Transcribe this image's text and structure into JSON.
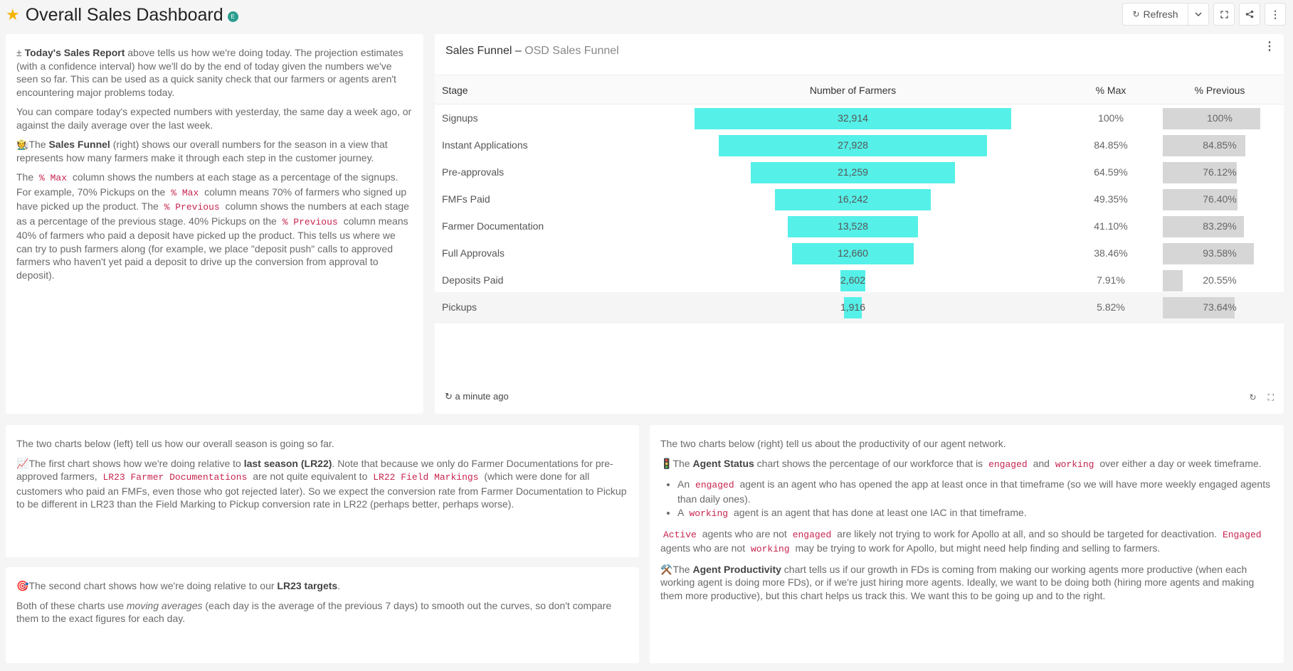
{
  "header": {
    "title": "Overall Sales Dashboard",
    "star_icon": "star-icon",
    "certified_badge": "E",
    "refresh_label": "Refresh"
  },
  "intro": {
    "p1_icon": "±",
    "p1_bold": "Today's Sales Report",
    "p1_rest": " above tells us how we're doing today. The projection estimates (with a confidence interval) how we'll do by the end of today given the numbers we've seen so far. This can be used as a quick sanity check that our farmers or agents aren't encountering major problems today.",
    "p2": "You can compare today's expected numbers with yesterday, the same day a week ago, or against the daily average over the last week.",
    "p3_icon": "🧑‍🌾",
    "p3_a": "The ",
    "p3_bold": "Sales Funnel",
    "p3_b": " (right) shows our overall numbers for the season in a view that represents how many farmers make it through each step in the customer journey.",
    "p4_a": "The ",
    "p4_code1": "% Max",
    "p4_b": " column shows the numbers at each stage as a percentage of the signups. For example, 70% Pickups on the ",
    "p4_code2": "% Max",
    "p4_c": " column means 70% of farmers who signed up have picked up the product. The ",
    "p4_code3": "% Previous",
    "p4_d": " column shows the numbers at each stage as a percentage of the previous stage. 40% Pickups on the ",
    "p4_code4": "% Previous",
    "p4_e": " column means 40% of farmers who paid a deposit have picked up the product. This tells us where we can try to push farmers along (for example, we place \"deposit push\" calls to approved farmers who haven't yet paid a deposit to drive up the conversion from approval to deposit)."
  },
  "funnel": {
    "title": "Sales Funnel",
    "dash": " – ",
    "subtitle": "OSD Sales Funnel",
    "columns": [
      "Stage",
      "Number of Farmers",
      "% Max",
      "% Previous"
    ],
    "bar_color": "#55f0e8",
    "prev_bar_color": "#d6d6d6",
    "rows": [
      {
        "stage": "Signups",
        "farmers": "32,914",
        "pct_max": "100%",
        "pct_prev": "100%",
        "prev_frac": 1.0
      },
      {
        "stage": "Instant Applications",
        "farmers": "27,928",
        "pct_max": "84.85%",
        "pct_prev": "84.85%",
        "prev_frac": 0.8485
      },
      {
        "stage": "Pre-approvals",
        "farmers": "21,259",
        "pct_max": "64.59%",
        "pct_prev": "76.12%",
        "prev_frac": 0.7612
      },
      {
        "stage": "FMFs Paid",
        "farmers": "16,242",
        "pct_max": "49.35%",
        "pct_prev": "76.40%",
        "prev_frac": 0.764
      },
      {
        "stage": "Farmer Documentation",
        "farmers": "13,528",
        "pct_max": "41.10%",
        "pct_prev": "83.29%",
        "prev_frac": 0.8329
      },
      {
        "stage": "Full Approvals",
        "farmers": "12,660",
        "pct_max": "38.46%",
        "pct_prev": "93.58%",
        "prev_frac": 0.9358
      },
      {
        "stage": "Deposits Paid",
        "farmers": "2,602",
        "pct_max": "7.91%",
        "pct_prev": "20.55%",
        "prev_frac": 0.2055
      },
      {
        "stage": "Pickups",
        "farmers": "1,916",
        "pct_max": "5.82%",
        "pct_prev": "73.64%",
        "prev_frac": 0.7364
      }
    ],
    "updated": "a minute ago"
  },
  "season": {
    "p1": "The two charts below (left) tell us how our overall season is going so far.",
    "p2_icon": "📈",
    "p2_a": "The first chart shows how we're doing relative to ",
    "p2_bold": "last season (LR22)",
    "p2_b": ". Note that because we only do Farmer Documentations for pre-approved farmers, ",
    "p2_code1": "LR23 Farmer Documentations",
    "p2_c": " are not quite equivalent to ",
    "p2_code2": "LR22 Field Markings",
    "p2_d": " (which were done for all customers who paid an FMFs, even those who got rejected later). So we expect the conversion rate from Farmer Documentation to Pickup to be different in LR23 than the Field Marking to Pickup conversion rate in LR22 (perhaps better, perhaps worse)."
  },
  "targets": {
    "p1_icon": "🎯",
    "p1_a": "The second chart shows how we're doing relative to our ",
    "p1_bold": "LR23 targets",
    "p1_b": ".",
    "p2_a": "Both of these charts use ",
    "p2_em": "moving averages",
    "p2_b": " (each day is the average of the previous 7 days) to smooth out the curves, so don't compare them to the exact figures for each day."
  },
  "agents": {
    "p1": "The two charts below (right) tell us about the productivity of our agent network.",
    "p2_icon": "🚦",
    "p2_a": "The ",
    "p2_bold": "Agent Status",
    "p2_b": " chart shows the percentage of our workforce that is ",
    "p2_code1": "engaged",
    "p2_c": " and ",
    "p2_code2": "working",
    "p2_d": " over either a day or week timeframe.",
    "li1_a": "An ",
    "li1_code": "engaged",
    "li1_b": " agent is an agent who has opened the app at least once in that timeframe (so we will have more weekly engaged agents than daily ones).",
    "li2_a": "A ",
    "li2_code": "working",
    "li2_b": " agent is an agent that has done at least one IAC in that timeframe.",
    "p3_code1": "Active",
    "p3_a": " agents who are not ",
    "p3_code2": "engaged",
    "p3_b": " are likely not trying to work for Apollo at all, and so should be targeted for deactivation. ",
    "p3_code3": "Engaged",
    "p3_c": " agents who are not ",
    "p3_code4": "working",
    "p3_d": " may be trying to work for Apollo, but might need help finding and selling to farmers.",
    "p4_icon": "⚒️",
    "p4_a": "The ",
    "p4_bold": "Agent Productivity",
    "p4_b": " chart tells us if our growth in FDs is coming from making our working agents more productive (when each working agent is doing more FDs), or if we're just hiring more agents. Ideally, we want to be doing both (hiring more agents and making them more productive), but this chart helps us track this. We want this to be going up and to the right."
  }
}
